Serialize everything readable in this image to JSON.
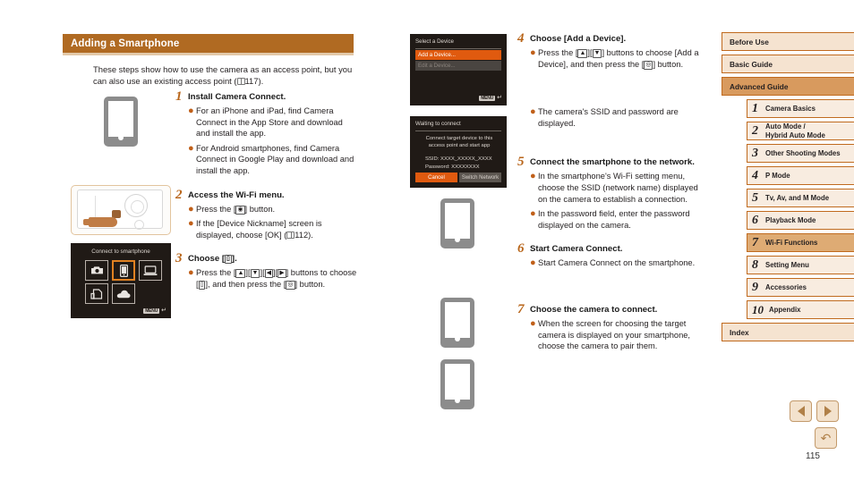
{
  "page": {
    "number": "115",
    "section_title": "Adding a Smartphone",
    "intro": "These steps show how to use the camera as an access point, but you can also use an existing access point ( 117)."
  },
  "steps_left": [
    {
      "num": "1",
      "title": "Install Camera Connect.",
      "bullets": [
        "For an iPhone and iPad, find Camera Connect in the App Store and download and install the app.",
        "For Android smartphones, find Camera Connect in Google Play and download and install the app."
      ]
    },
    {
      "num": "2",
      "title": "Access the Wi-Fi menu.",
      "bullets": [
        "Press the [ᵜᵀᵜ] button.",
        "If the [Device Nickname] screen is displayed, choose [OK] ( 112)."
      ]
    },
    {
      "num": "3",
      "title": "Choose [□].",
      "bullets": [
        "Press the [▲][▼][◄][►] buttons to choose [□], and then press the [Ⓐ] button."
      ]
    }
  ],
  "steps_mid": [
    {
      "num": "4",
      "title": "Choose [Add a Device].",
      "bullets": [
        "Press the [▲][▼] buttons to choose [Add a Device], and then press the [Ⓐ] button.",
        "The camera's SSID and password are displayed."
      ]
    },
    {
      "num": "5",
      "title": "Connect the smartphone to the network.",
      "bullets": [
        "In the smartphone's Wi-Fi setting menu, choose the SSID (network name) displayed on the camera to establish a connection.",
        "In the password field, enter the password displayed on the camera."
      ]
    },
    {
      "num": "6",
      "title": "Start Camera Connect.",
      "bullets": [
        "Start Camera Connect on the smartphone."
      ]
    },
    {
      "num": "7",
      "title": "Choose the camera to connect.",
      "bullets": [
        "When the screen for choosing the target camera is displayed on your smartphone, choose the camera to pair them."
      ]
    }
  ],
  "lcd_wifi_menu": {
    "title": "Connect to smartphone",
    "icons": [
      "camera-icon",
      "smartphone-icon",
      "computer-icon",
      "printer-icon",
      "cloud-icon"
    ],
    "menu_chip": "MENU",
    "selected_index": 1
  },
  "lcd_select_device": {
    "title": "Select a Device",
    "rows": [
      "Add a Device...",
      "Edit a Device..."
    ],
    "menu_chip": "MENU"
  },
  "lcd_waiting": {
    "title": "Waiting to connect",
    "message": "Connect target device to this access point and start app",
    "ssid_label": "SSID:",
    "ssid_value": "XXXX_XXXXX_XXXX",
    "password_label": "Password:",
    "password_value": "XXXXXXXX",
    "cancel_label": "Cancel",
    "switch_label": "Switch Network"
  },
  "sidebar": {
    "top_items": [
      {
        "label": "Before Use",
        "active": false
      },
      {
        "label": "Basic Guide",
        "active": false
      },
      {
        "label": "Advanced Guide",
        "active": true
      }
    ],
    "chapters": [
      {
        "num": "1",
        "label": "Camera Basics",
        "active": false
      },
      {
        "num": "2",
        "label": "Auto Mode /\nHybrid Auto Mode",
        "active": false
      },
      {
        "num": "3",
        "label": "Other Shooting Modes",
        "active": false
      },
      {
        "num": "4",
        "label": "P Mode",
        "active": false
      },
      {
        "num": "5",
        "label": "Tv, Av, and M Mode",
        "active": false
      },
      {
        "num": "6",
        "label": "Playback Mode",
        "active": false
      },
      {
        "num": "7",
        "label": "Wi-Fi Functions",
        "active": true
      },
      {
        "num": "8",
        "label": "Setting Menu",
        "active": false
      },
      {
        "num": "9",
        "label": "Accessories",
        "active": false
      },
      {
        "num": "10",
        "label": "Appendix",
        "active": false
      }
    ],
    "index_label": "Index"
  },
  "pagenav": {
    "prev_icon": "triangle-left-icon",
    "next_icon": "triangle-right-icon",
    "back_icon": "return-arrow-icon"
  },
  "colors": {
    "header_bar": "#b06a22",
    "accent": "#c0601a",
    "sidebar_border": "#c06a1e",
    "sidebar_fill": "#f5e3d0",
    "sidebar_active": "#d89a5e",
    "lcd_bg": "#201a16",
    "lcd_highlight": "#e05a0f"
  }
}
